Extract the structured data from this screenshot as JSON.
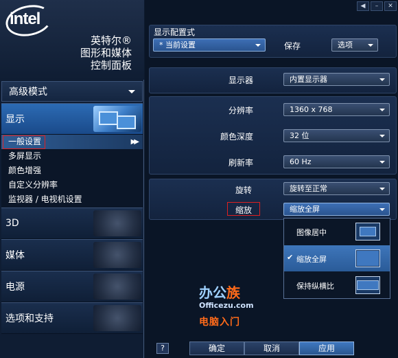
{
  "brand": {
    "logo": "intel",
    "title_lines": [
      "英特尔®",
      "图形和媒体",
      "控制面板"
    ]
  },
  "sidebar": {
    "mode": "高级模式",
    "categories": {
      "display": "显示",
      "threed": "3D",
      "media": "媒体",
      "power": "电源",
      "options": "选项和支持"
    },
    "display_items": [
      "一般设置",
      "多屏显示",
      "颜色增强",
      "自定义分辨率",
      "监视器 / 电视机设置"
    ]
  },
  "window_controls": {
    "back": "◀",
    "minimize": "–",
    "close": "✕"
  },
  "profile": {
    "section_label": "显示配置式",
    "current": "当前设置",
    "save": "保存",
    "options": "选项"
  },
  "settings": {
    "display": {
      "label": "显示器",
      "value": "内置显示器"
    },
    "resolution": {
      "label": "分辨率",
      "value": "1360 x 768"
    },
    "color_depth": {
      "label": "颜色深度",
      "value": "32 位"
    },
    "refresh_rate": {
      "label": "刷新率",
      "value": "60 Hz"
    },
    "rotation": {
      "label": "旋转",
      "value": "旋转至正常"
    },
    "scaling": {
      "label": "缩放",
      "value": "缩放全屏"
    }
  },
  "scaling_options": [
    {
      "label": "图像居中",
      "selected": false,
      "icon": "center-image-icon"
    },
    {
      "label": "缩放全屏",
      "selected": true,
      "icon": "scale-full-icon"
    },
    {
      "label": "保持纵横比",
      "selected": false,
      "icon": "aspect-ratio-icon"
    }
  ],
  "watermark": {
    "title_a": "办公",
    "title_b": "族",
    "url": "Officezu.com",
    "subtitle": "电脑入门"
  },
  "footer": {
    "help": "?",
    "ok": "确定",
    "cancel": "取消",
    "apply": "应用"
  }
}
